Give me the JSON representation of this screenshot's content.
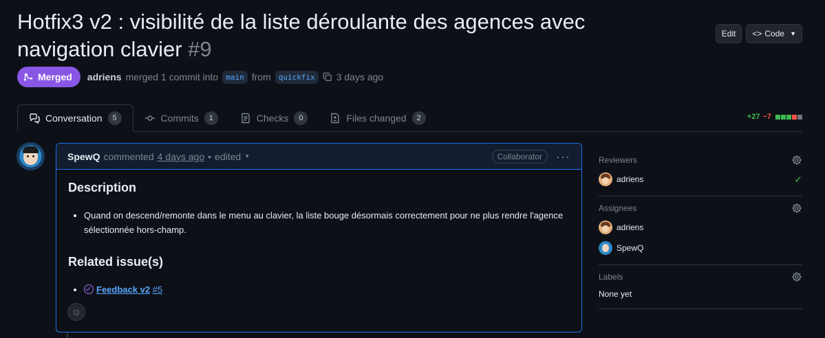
{
  "header": {
    "title": "Hotfix3 v2 : visibilité de la liste déroulante des agences avec navigation clavier",
    "number": "#9",
    "edit_label": "Edit",
    "code_label": "Code"
  },
  "meta": {
    "state": "Merged",
    "author": "adriens",
    "text1": "merged 1 commit into",
    "base_branch": "main",
    "text2": "from",
    "head_branch": "quickfix",
    "time": "3 days ago"
  },
  "tabs": [
    {
      "label": "Conversation",
      "count": "5",
      "icon": "comment-icon"
    },
    {
      "label": "Commits",
      "count": "1",
      "icon": "commit-icon"
    },
    {
      "label": "Checks",
      "count": "0",
      "icon": "checklist-icon"
    },
    {
      "label": "Files changed",
      "count": "2",
      "icon": "file-diff-icon"
    }
  ],
  "diffstat": {
    "additions": "+27",
    "deletions": "−7",
    "colors": [
      "#3fb950",
      "#3fb950",
      "#3fb950",
      "#f85149",
      "#6e7681"
    ]
  },
  "comment": {
    "author": "SpewQ",
    "action": "commented",
    "time": "4 days ago",
    "edited": "edited",
    "role": "Collaborator",
    "heading1": "Description",
    "bullet1": "Quand on descend/remonte dans le menu au clavier, la liste bouge désormais correctement pour ne plus rendre l'agence sélectionnée hors-champ.",
    "heading2": "Related issue(s)",
    "issue_title": "Feedback v2",
    "issue_number": "#5"
  },
  "sidebar": {
    "reviewers_title": "Reviewers",
    "reviewers": [
      {
        "name": "adriens",
        "approved": true
      }
    ],
    "assignees_title": "Assignees",
    "assignees": [
      {
        "name": "adriens"
      },
      {
        "name": "SpewQ"
      }
    ],
    "labels_title": "Labels",
    "labels_value": "None yet"
  },
  "colors": {
    "merged": "#8957e5",
    "link": "#58a6ff",
    "accent_border": "#1f6feb"
  }
}
